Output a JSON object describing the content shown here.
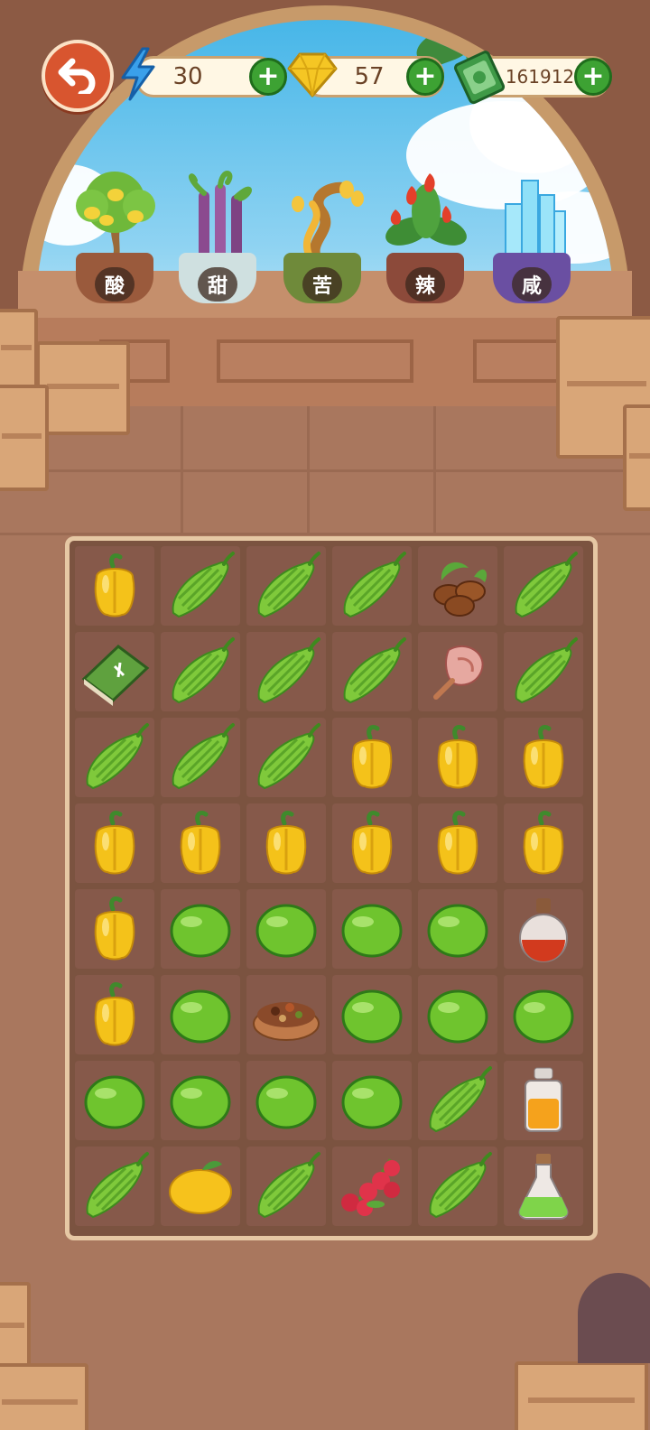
{
  "hud": {
    "energy": {
      "value": "30",
      "icon": "lightning-icon",
      "add_icon": "plus-icon"
    },
    "gems": {
      "value": "57",
      "icon": "gem-icon",
      "add_icon": "plus-icon"
    },
    "cash": {
      "value": "161912",
      "icon": "cash-icon",
      "add_icon": "plus-icon"
    },
    "back_icon": "back-arrow-icon"
  },
  "plants": [
    {
      "label": "酸",
      "name": "lemon-tree"
    },
    {
      "label": "甜",
      "name": "sugarcane"
    },
    {
      "label": "苦",
      "name": "bitter-tree"
    },
    {
      "label": "辣",
      "name": "chili-plant"
    },
    {
      "label": "咸",
      "name": "salt-crystal"
    }
  ],
  "board": {
    "rows": 8,
    "cols": 6,
    "cells": [
      [
        "pepper",
        "gourd",
        "gourd",
        "gourd",
        "coffee",
        "gourd"
      ],
      [
        "book",
        "gourd",
        "gourd",
        "gourd",
        "meat",
        "gourd"
      ],
      [
        "gourd",
        "gourd",
        "gourd",
        "pepper",
        "pepper",
        "pepper"
      ],
      [
        "pepper",
        "pepper",
        "pepper",
        "pepper",
        "pepper",
        "pepper"
      ],
      [
        "pepper",
        "lime",
        "lime",
        "lime",
        "lime",
        "red-potion"
      ],
      [
        "pepper",
        "lime",
        "spices",
        "lime",
        "lime",
        "lime"
      ],
      [
        "lime",
        "lime",
        "lime",
        "lime",
        "gourd",
        "orange-potion"
      ],
      [
        "gourd",
        "lemon",
        "gourd",
        "berries",
        "gourd",
        "green-potion"
      ]
    ]
  },
  "colors": {
    "board": "#7b5340",
    "cell": "#86594a",
    "plus": "#3da233",
    "back": "#d8552f"
  }
}
